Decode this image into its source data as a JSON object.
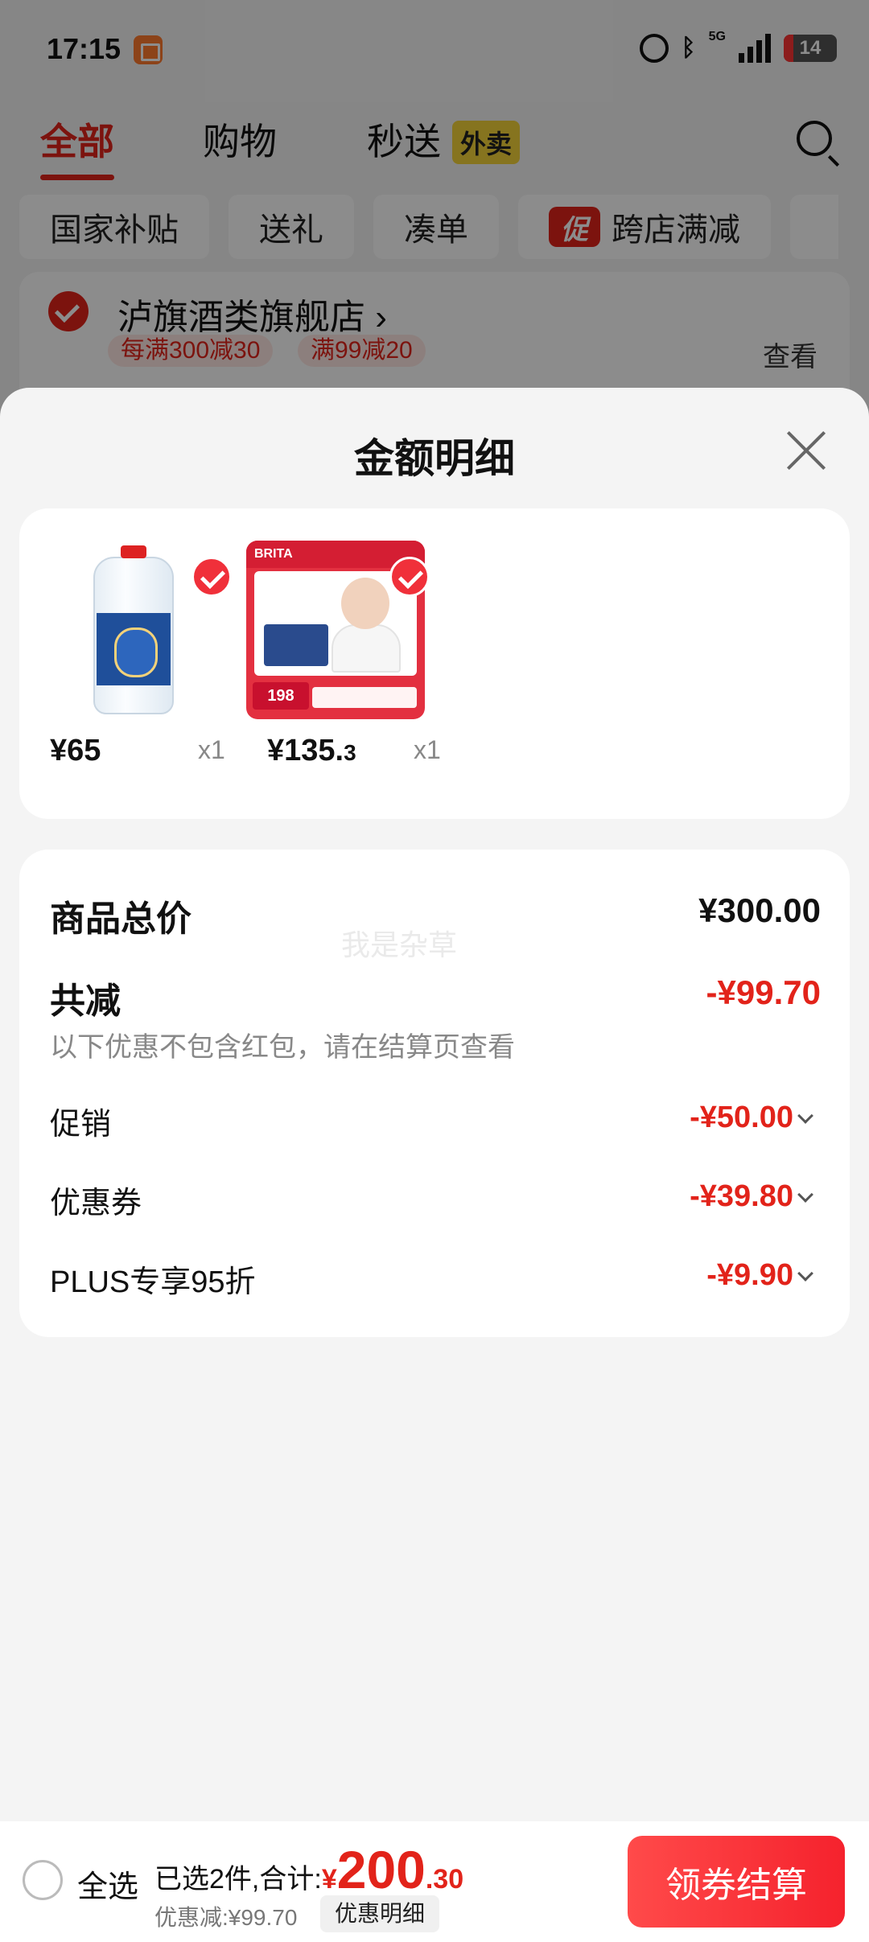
{
  "status_bar": {
    "time": "17:15",
    "network": "5G",
    "battery": "14"
  },
  "top_tabs": {
    "all": "全部",
    "shopping": "购物",
    "express": "秒送",
    "takeout_badge": "外卖"
  },
  "filters": [
    "国家补贴",
    "送礼",
    "凑单",
    "跨店满减"
  ],
  "promo_tag": "促",
  "shop": {
    "name": "泸旗酒类旗舰店",
    "coupons": [
      "每满300减30",
      "满99减20"
    ],
    "view": "查看"
  },
  "sheet": {
    "title": "金额明细",
    "watermark": "我是杂草",
    "products": [
      {
        "price_main": "¥65",
        "price_decimal": "",
        "qty": "x1",
        "image": "water-bottle"
      },
      {
        "price_main": "¥135.",
        "price_decimal": "3",
        "qty": "x1",
        "image": "brita-filter",
        "image_text": {
          "brand": "BRITA",
          "badge_price": "198"
        }
      }
    ],
    "summary": {
      "total_label": "商品总价",
      "total_value": "¥300.00",
      "reduce_label": "共减",
      "reduce_value": "-¥99.70",
      "note": "以下优惠不包含红包，请在结算页查看",
      "rows": [
        {
          "label": "促销",
          "value": "-¥50.00"
        },
        {
          "label": "优惠券",
          "value": "-¥39.80"
        },
        {
          "label": "PLUS专享95折",
          "value": "-¥9.90"
        }
      ]
    }
  },
  "bottom_bar": {
    "select_all": "全选",
    "selected_text": "已选2件,合计:",
    "currency": "¥",
    "total_int": "200",
    "total_dec": ".30",
    "discount": "优惠减:¥99.70",
    "detail_button": "优惠明细",
    "checkout": "领券结算"
  },
  "colors": {
    "accent": "#e2231a",
    "takeout_badge": "#f5d33a",
    "checkout_gradient": [
      "#ff4a4a",
      "#f5222d"
    ]
  }
}
